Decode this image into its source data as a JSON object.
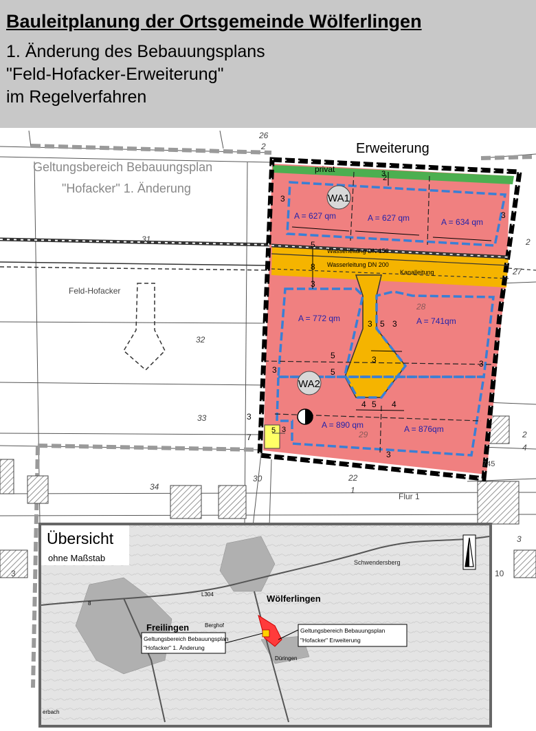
{
  "header": {
    "title": "Bauleitplanung der Ortsgemeinde Wölferlingen",
    "line1": "1. Änderung des Bebauungsplans",
    "line2": "\"Feld-Hofacker-Erweiterung\"",
    "line3": "im Regelverfahren"
  },
  "map": {
    "erweiterung_label": "Erweiterung",
    "old_plan_line1": "Geltungsbereich Bebauungsplan",
    "old_plan_line2": "\"Hofacker\" 1. Änderung",
    "feld_hofacker": "Feld-Hofacker",
    "privat": "privat",
    "wa1": "WA1",
    "wa2": "WA2",
    "areas": [
      "A = 627 qm",
      "A = 627 qm",
      "A = 634 qm",
      "A = 772 qm",
      "A = 741qm",
      "A = 890 qm",
      "A = 876qm"
    ],
    "water1": "Wasserleitung DN 150",
    "water2": "Wasserleitung DN 200",
    "kanal": "Kanalleitung",
    "parcels": [
      "26",
      "2",
      "31",
      "27",
      "32",
      "33",
      "34",
      "28",
      "29",
      "30",
      "22",
      "1",
      "745",
      "2",
      "4",
      "2",
      "3",
      "10",
      "3"
    ],
    "flur": "Flur 1",
    "dims": [
      "3",
      "3",
      "2",
      "3",
      "5",
      "8",
      "3",
      "3",
      "5",
      "3",
      "5",
      "5",
      "3",
      "3",
      "3",
      "4",
      "5",
      "4",
      "3",
      "3",
      "7",
      "5",
      "3"
    ]
  },
  "inset": {
    "title": "Übersicht",
    "subtitle": "ohne Maßstab",
    "town1": "Wölferlingen",
    "town2": "Freilingen",
    "town3": "Düringen",
    "road": "L304",
    "hill": "Schwendersberg",
    "label_left_line1": "Geltungsbereich Bebauungsplan",
    "label_left_line2": "\"Hofacker\" 1. Änderung",
    "label_right_line1": "Geltungsbereich Bebauungsplan",
    "label_right_line2": "\"Hofacker\" Erweiterung",
    "small_labels": [
      "8",
      "Berghof",
      "erbach"
    ]
  }
}
